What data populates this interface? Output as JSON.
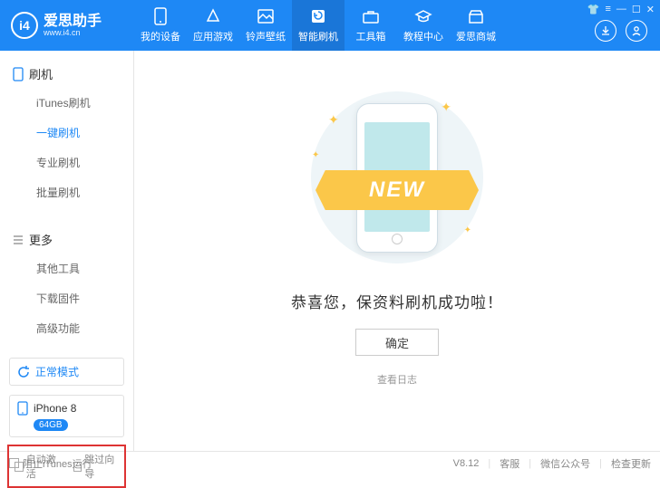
{
  "app": {
    "name_cn": "爱思助手",
    "name_en": "www.i4.cn",
    "logo_text": "i4"
  },
  "nav": [
    {
      "label": "我的设备"
    },
    {
      "label": "应用游戏"
    },
    {
      "label": "铃声壁纸"
    },
    {
      "label": "智能刷机"
    },
    {
      "label": "工具箱"
    },
    {
      "label": "教程中心"
    },
    {
      "label": "爱思商城"
    }
  ],
  "sidebar": {
    "group1": {
      "title": "刷机",
      "items": [
        "iTunes刷机",
        "一键刷机",
        "专业刷机",
        "批量刷机"
      ],
      "active": 1
    },
    "group2": {
      "title": "更多",
      "items": [
        "其他工具",
        "下载固件",
        "高级功能"
      ]
    },
    "mode": "正常模式",
    "device": {
      "name": "iPhone 8",
      "storage": "64GB"
    },
    "checks": {
      "auto_activate": "自动激活",
      "skip_wizard": "跳过向导"
    }
  },
  "main": {
    "ribbon": "NEW",
    "success": "恭喜您，保资料刷机成功啦！",
    "confirm": "确定",
    "view_log": "查看日志"
  },
  "footer": {
    "block_itunes": "阻止iTunes运行",
    "version": "V8.12",
    "support": "客服",
    "wechat": "微信公众号",
    "check_update": "检查更新"
  }
}
